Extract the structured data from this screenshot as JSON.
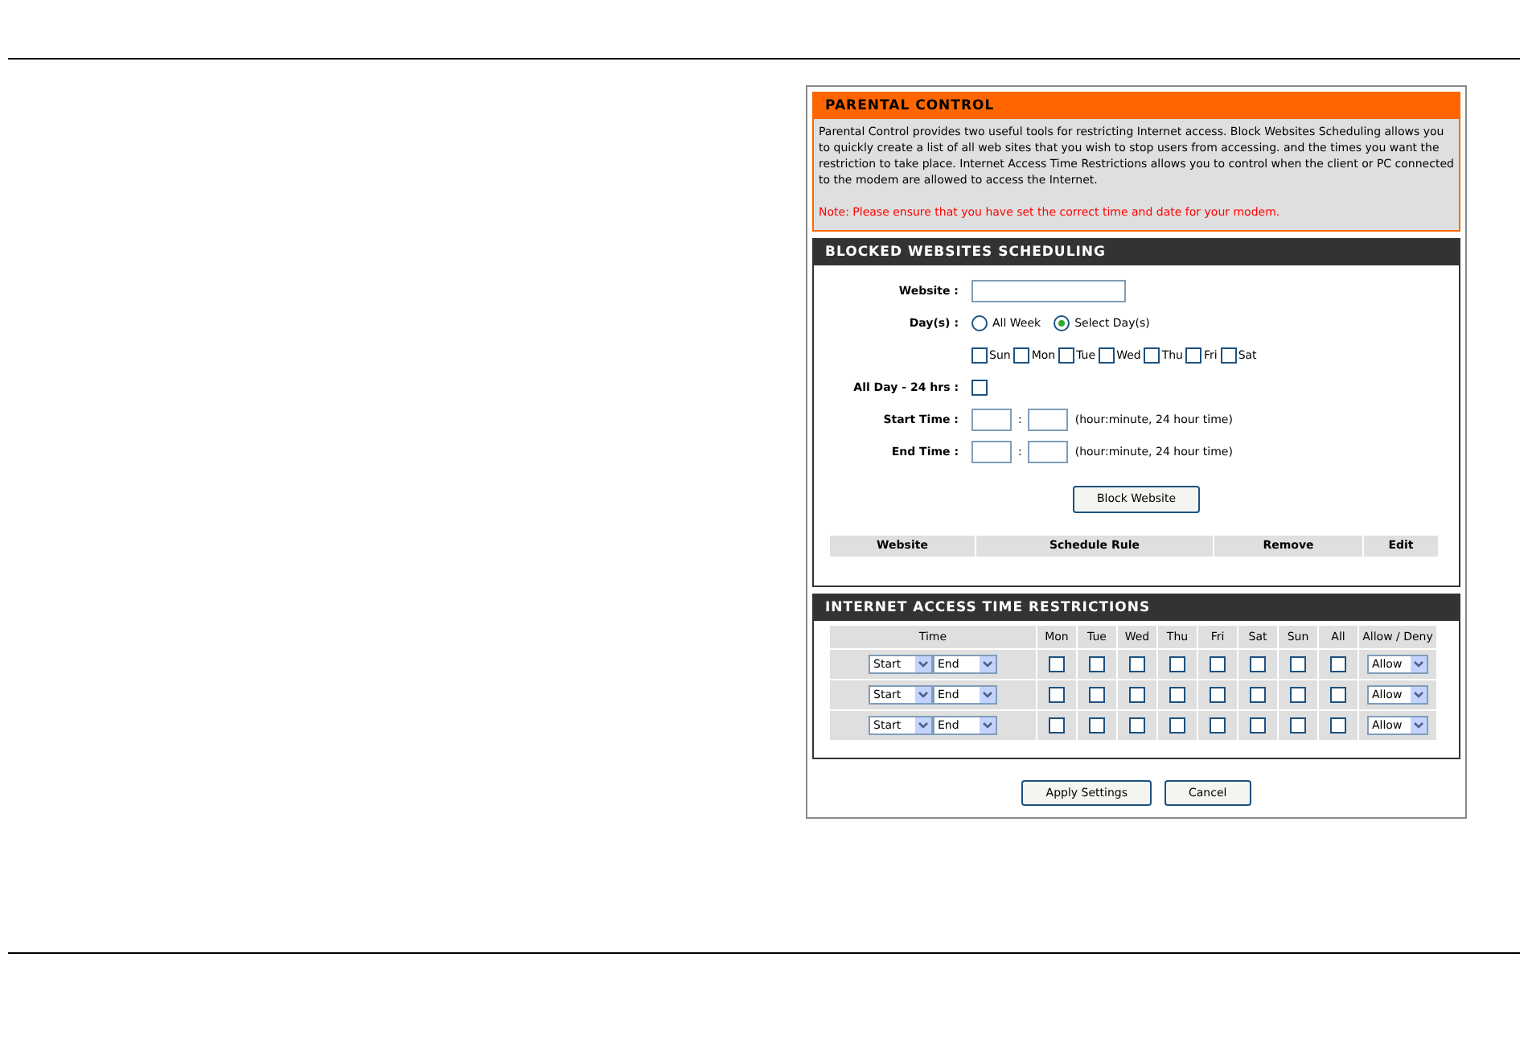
{
  "parental_control": {
    "title": "PARENTAL CONTROL",
    "description": "Parental Control provides two useful tools for restricting Internet access. Block Websites Scheduling allows you to quickly create a list of all web sites that you wish to stop users from accessing. and the times you want the restriction to take place. Internet Access Time Restrictions allows you to control when the client or PC connected to the modem are allowed to access the Internet.",
    "note": "Note: Please ensure that you have set the correct time and date for your modem."
  },
  "blocked_websites": {
    "title": "BLOCKED WEBSITES SCHEDULING",
    "website_label": "Website :",
    "days_label": "Day(s) :",
    "day_modes": [
      {
        "label": "All Week",
        "selected": false
      },
      {
        "label": "Select Day(s)",
        "selected": true
      }
    ],
    "days": [
      {
        "label": "Sun",
        "checked": false
      },
      {
        "label": "Mon",
        "checked": false
      },
      {
        "label": "Tue",
        "checked": false
      },
      {
        "label": "Wed",
        "checked": false
      },
      {
        "label": "Thu",
        "checked": false
      },
      {
        "label": "Fri",
        "checked": false
      },
      {
        "label": "Sat",
        "checked": false
      }
    ],
    "all_day": {
      "label": "All Day - 24 hrs :",
      "checked": false
    },
    "time_rows": [
      {
        "label": "Start Time :",
        "separator": ":",
        "hint": "(hour:minute, 24 hour time)"
      },
      {
        "label": "End Time :",
        "separator": ":",
        "hint": "(hour:minute, 24 hour time)"
      }
    ],
    "block_button": "Block Website",
    "columns": [
      "Website",
      "Schedule Rule",
      "Remove",
      "Edit"
    ]
  },
  "internet_access": {
    "title": "INTERNET ACCESS TIME RESTRICTIONS",
    "columns": [
      "Time",
      "Mon",
      "Tue",
      "Wed",
      "Thu",
      "Fri",
      "Sat",
      "Sun",
      "All",
      "Allow / Deny"
    ],
    "rows": [
      {
        "start": "Start",
        "end": "End",
        "days": [
          {
            "checked": false
          },
          {
            "checked": false
          },
          {
            "checked": false
          },
          {
            "checked": false
          },
          {
            "checked": false
          },
          {
            "checked": false
          },
          {
            "checked": false
          },
          {
            "checked": false
          }
        ],
        "action": "Allow"
      },
      {
        "start": "Start",
        "end": "End",
        "days": [
          {
            "checked": false
          },
          {
            "checked": false
          },
          {
            "checked": false
          },
          {
            "checked": false
          },
          {
            "checked": false
          },
          {
            "checked": false
          },
          {
            "checked": false
          },
          {
            "checked": false
          }
        ],
        "action": "Allow"
      },
      {
        "start": "Start",
        "end": "End",
        "days": [
          {
            "checked": false
          },
          {
            "checked": false
          },
          {
            "checked": false
          },
          {
            "checked": false
          },
          {
            "checked": false
          },
          {
            "checked": false
          },
          {
            "checked": false
          },
          {
            "checked": false
          }
        ],
        "action": "Allow"
      }
    ]
  },
  "buttons": [
    "Apply Settings",
    "Cancel"
  ]
}
